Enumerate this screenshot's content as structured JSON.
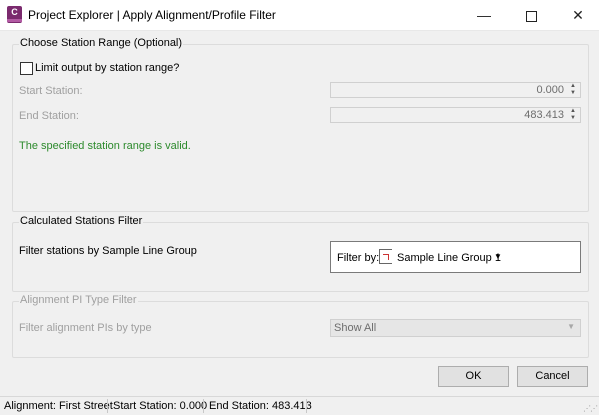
{
  "window": {
    "app_icon_letter": "C",
    "title": "Project Explorer | Apply Alignment/Profile Filter",
    "minimize": "—",
    "close": "✕"
  },
  "station_range": {
    "group_title": "Choose Station Range (Optional)",
    "limit_label": "Limit output by station range?",
    "limit_checked": false,
    "start_label": "Start Station:",
    "start_value": "0.000",
    "end_label": "End Station:",
    "end_value": "483.413",
    "valid_message": "The specified station range is valid.",
    "valid_color": "#2c8a2c"
  },
  "calculated_filter": {
    "group_title": "Calculated Stations Filter",
    "label": "Filter stations by Sample Line Group",
    "filter_by_label": "Filter by:",
    "filter_value": "Sample Line Group 1",
    "icon": "sample-line-group-icon"
  },
  "pi_filter": {
    "group_title": "Alignment PI Type Filter",
    "label": "Filter alignment PIs by type",
    "selected": "Show All"
  },
  "buttons": {
    "ok": "OK",
    "cancel": "Cancel"
  },
  "status": {
    "alignment": "Alignment: First Street",
    "start": "Start Station: 0.000",
    "end": "End Station: 483.413"
  }
}
